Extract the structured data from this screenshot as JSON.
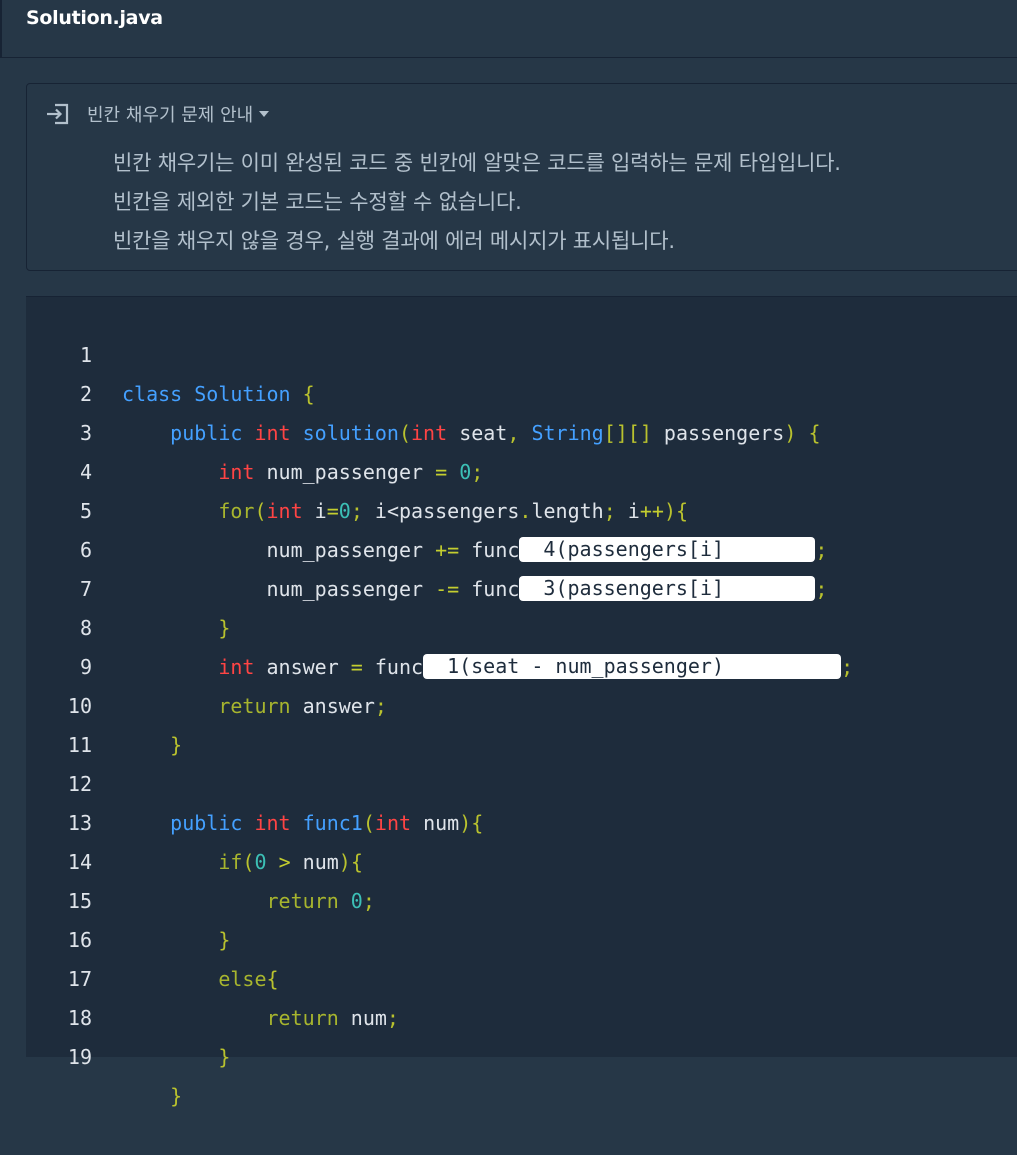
{
  "file": {
    "title": "Solution.java"
  },
  "guide": {
    "title": "빈칸 채우기 문제 안내",
    "lines": [
      "빈칸 채우기는 이미 완성된 코드 중 빈칸에 알맞은 코드를 입력하는 문제 타입입니다.",
      "빈칸을 제외한 기본 코드는 수정할 수 없습니다.",
      "빈칸을 채우지 않을 경우, 실행 결과에 에러 메시지가 표시됩니다."
    ]
  },
  "editor": {
    "line_numbers": [
      "1",
      "2",
      "3",
      "4",
      "5",
      "6",
      "7",
      "8",
      "9",
      "10",
      "11",
      "12",
      "13",
      "14",
      "15",
      "16",
      "17",
      "18",
      "19"
    ],
    "code": {
      "l1": {
        "kw_class": "class",
        "name": "Solution",
        "brace": "{"
      },
      "l2": {
        "public": "public",
        "int": "int",
        "fn": "solution",
        "open": "(",
        "int2": "int",
        "seat": "seat",
        "comma": ",",
        "string": "String",
        "brackets": "[][]",
        "passengers": "passengers",
        "close": ")",
        "brace": "{"
      },
      "l3": {
        "int": "int",
        "var": "num_passenger",
        "eq": "=",
        "zero": "0",
        "semi": ";"
      },
      "l4": {
        "for": "for",
        "open": "(",
        "int": "int",
        "i": "i",
        "eq": "=",
        "zero": "0",
        "semi": ";",
        "cond": "i<passengers",
        "dot": ".",
        "length": "length",
        "semi2": ";",
        "inc_i": "i",
        "inc": "++",
        "close": ")",
        "brace": "{"
      },
      "l5": {
        "var": "num_passenger",
        "op": "+=",
        "fn": "func",
        "blank": "4(passengers[i]",
        "semi": ";"
      },
      "l6": {
        "var": "num_passenger",
        "op": "-=",
        "fn": "func",
        "blank": "3(passengers[i]",
        "semi": ";"
      },
      "l7": {
        "brace": "}"
      },
      "l8": {
        "int": "int",
        "var": "answer",
        "eq": "=",
        "fn": "func",
        "blank": "1(seat - num_passenger)",
        "semi": ";"
      },
      "l9": {
        "ret": "return",
        "var": "answer",
        "semi": ";"
      },
      "l10": {
        "brace": "}"
      },
      "l12": {
        "public": "public",
        "int": "int",
        "fn": "func1",
        "open": "(",
        "int2": "int",
        "num": "num",
        "close": ")",
        "brace": "{"
      },
      "l13": {
        "if": "if",
        "open": "(",
        "zero": "0",
        "gt": ">",
        "num": "num",
        "close": ")",
        "brace": "{"
      },
      "l14": {
        "ret": "return",
        "zero": "0",
        "semi": ";"
      },
      "l15": {
        "brace": "}"
      },
      "l16": {
        "else": "else",
        "brace": "{"
      },
      "l17": {
        "ret": "return",
        "num": "num",
        "semi": ";"
      },
      "l18": {
        "brace": "}"
      },
      "l19": {
        "brace": "}"
      }
    }
  },
  "colors": {
    "background": "#263747",
    "editor_bg": "#1e2c3c",
    "keyword_blue": "#44a0ff",
    "keyword_red": "#ff4444",
    "keyword_green": "#a7b52e",
    "number": "#3cc0b6"
  }
}
